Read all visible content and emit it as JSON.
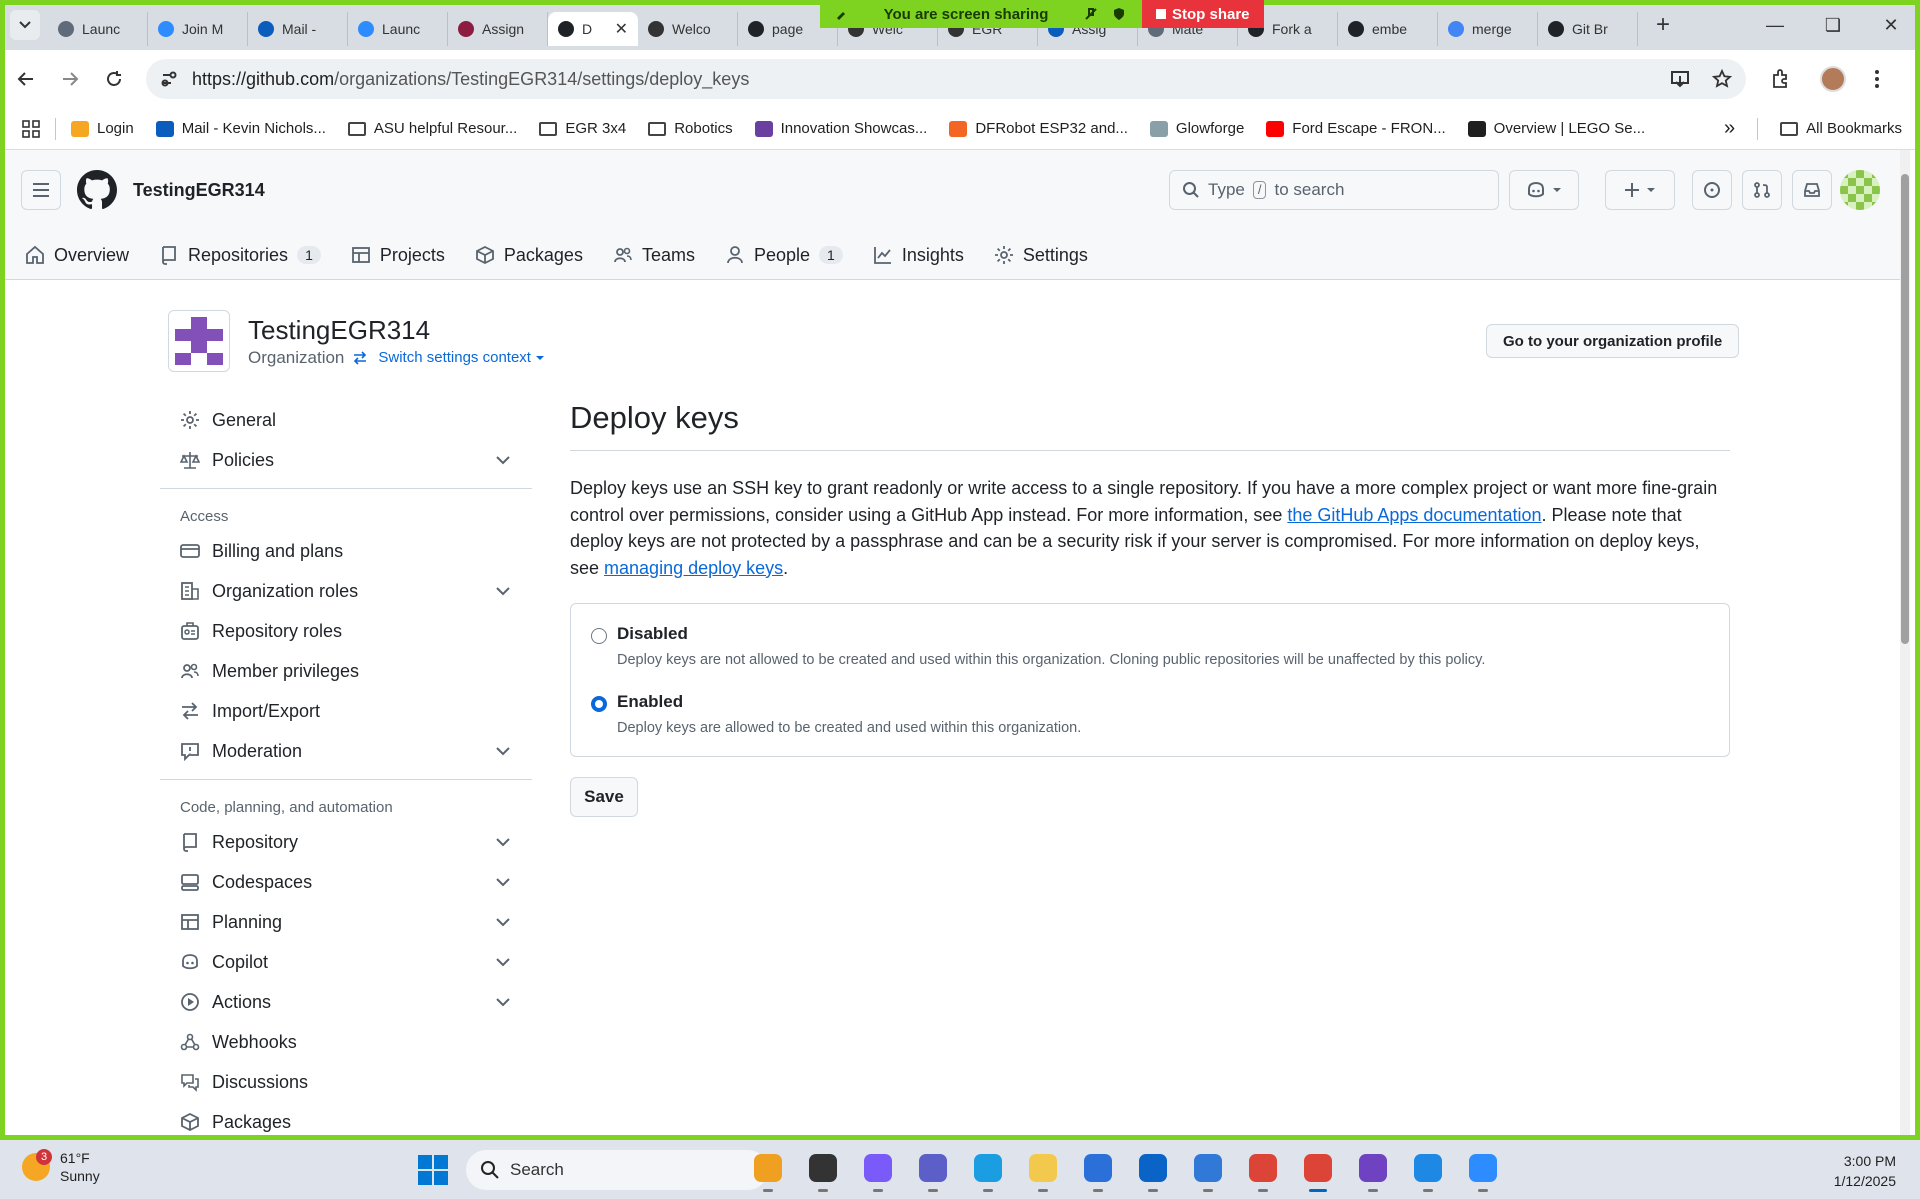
{
  "screen_share": {
    "status": "You are screen sharing",
    "stop_label": "Stop share"
  },
  "browser": {
    "tabs": [
      {
        "title": "Launc",
        "color": "#5f6b7a"
      },
      {
        "title": "Join M",
        "color": "#2d8cff"
      },
      {
        "title": "Mail -",
        "color": "#0a5cbd"
      },
      {
        "title": "Launc",
        "color": "#2d8cff"
      },
      {
        "title": "Assign",
        "color": "#8c1d40"
      },
      {
        "title": "D",
        "color": "#1f2328",
        "active": true
      },
      {
        "title": "Welco",
        "color": "#333333"
      },
      {
        "title": "page",
        "color": "#1f2328"
      },
      {
        "title": "Welc",
        "color": "#333333"
      },
      {
        "title": "EGR",
        "color": "#333333"
      },
      {
        "title": "Assig",
        "color": "#0a5cbd"
      },
      {
        "title": "Mate",
        "color": "#5f6b7a"
      },
      {
        "title": "Fork a",
        "color": "#1f2328"
      },
      {
        "title": "embe",
        "color": "#1f2328"
      },
      {
        "title": "merge",
        "color": "#4285f4"
      },
      {
        "title": "Git Br",
        "color": "#1f2328"
      }
    ],
    "url_host": "https://github.com",
    "url_path": "/organizations/TestingEGR314/settings/deploy_keys",
    "bookmarks": [
      {
        "label": "Login",
        "icon": "login-icon",
        "color": "#f5a623"
      },
      {
        "label": "Mail - Kevin Nichols...",
        "icon": "mail-icon",
        "color": "#0a5cbd"
      },
      {
        "label": "ASU helpful Resour...",
        "icon": "folder-icon"
      },
      {
        "label": "EGR 3x4",
        "icon": "folder-icon"
      },
      {
        "label": "Robotics",
        "icon": "folder-icon"
      },
      {
        "label": "Innovation Showcas...",
        "icon": "showcase-icon",
        "color": "#6b3fa0"
      },
      {
        "label": "DFRobot ESP32 and...",
        "icon": "dfrobot-icon",
        "color": "#f26522"
      },
      {
        "label": "Glowforge",
        "icon": "glowforge-icon",
        "color": "#8aa0a8"
      },
      {
        "label": "Ford Escape - FRON...",
        "icon": "youtube-icon",
        "color": "#ff0000"
      },
      {
        "label": "Overview | LEGO Se...",
        "icon": "lego-icon",
        "color": "#1f1f1f"
      }
    ],
    "all_bookmarks": "All Bookmarks"
  },
  "github": {
    "org_name": "TestingEGR314",
    "search_prefix": "Type",
    "search_key": "/",
    "search_suffix": "to search",
    "nav": [
      {
        "label": "Overview",
        "icon": "home-icon"
      },
      {
        "label": "Repositories",
        "icon": "repo-icon",
        "count": "1"
      },
      {
        "label": "Projects",
        "icon": "table-icon"
      },
      {
        "label": "Packages",
        "icon": "package-icon"
      },
      {
        "label": "Teams",
        "icon": "people-icon"
      },
      {
        "label": "People",
        "icon": "person-icon",
        "count": "1"
      },
      {
        "label": "Insights",
        "icon": "graph-icon"
      },
      {
        "label": "Settings",
        "icon": "gear-icon"
      }
    ]
  },
  "org_header": {
    "name": "TestingEGR314",
    "type": "Organization",
    "switch_label": "Switch settings context",
    "profile_button": "Go to your organization profile"
  },
  "sidebar": {
    "top": [
      {
        "label": "General",
        "icon": "gear-icon"
      },
      {
        "label": "Policies",
        "icon": "law-icon",
        "expandable": true
      }
    ],
    "access_heading": "Access",
    "access": [
      {
        "label": "Billing and plans",
        "icon": "credit-card-icon"
      },
      {
        "label": "Organization roles",
        "icon": "org-icon",
        "expandable": true
      },
      {
        "label": "Repository roles",
        "icon": "id-badge-icon"
      },
      {
        "label": "Member privileges",
        "icon": "people-icon"
      },
      {
        "label": "Import/Export",
        "icon": "arrow-switch-icon"
      },
      {
        "label": "Moderation",
        "icon": "report-icon",
        "expandable": true
      }
    ],
    "code_heading": "Code, planning, and automation",
    "code": [
      {
        "label": "Repository",
        "icon": "repo-icon",
        "expandable": true
      },
      {
        "label": "Codespaces",
        "icon": "codespaces-icon",
        "expandable": true
      },
      {
        "label": "Planning",
        "icon": "table-icon",
        "expandable": true
      },
      {
        "label": "Copilot",
        "icon": "copilot-icon",
        "expandable": true
      },
      {
        "label": "Actions",
        "icon": "play-icon",
        "expandable": true
      },
      {
        "label": "Webhooks",
        "icon": "webhook-icon"
      },
      {
        "label": "Discussions",
        "icon": "comment-discussion-icon"
      },
      {
        "label": "Packages",
        "icon": "package-icon"
      }
    ]
  },
  "main": {
    "title": "Deploy keys",
    "desc_1": "Deploy keys use an SSH key to grant readonly or write access to a single repository. If you have a more complex project or want more fine-grain control over permissions, consider using a GitHub App instead. For more information, see ",
    "desc_link_1": "the GitHub Apps documentation",
    "desc_2": ". Please note that deploy keys are not protected by a passphrase and can be a security risk if your server is compromised. For more information on deploy keys, see ",
    "desc_link_2": "managing deploy keys",
    "desc_3": ".",
    "options": [
      {
        "label": "Disabled",
        "hint": "Deploy keys are not allowed to be created and used within this organization. Cloning public repositories will be unaffected by this policy.",
        "checked": false
      },
      {
        "label": "Enabled",
        "hint": "Deploy keys are allowed to be created and used within this organization.",
        "checked": true
      }
    ],
    "save_label": "Save"
  },
  "taskbar": {
    "weather_badge": "3",
    "temperature": "61°F",
    "condition": "Sunny",
    "search_label": "Search",
    "time": "3:00 PM",
    "date": "1/12/2025",
    "apps": [
      {
        "name": "widgets-app-icon",
        "color": "#f0a020"
      },
      {
        "name": "file-viewer-icon",
        "color": "#333333"
      },
      {
        "name": "copilot-app-icon",
        "color": "#7a5af8"
      },
      {
        "name": "teams-icon",
        "color": "#5b5fc7"
      },
      {
        "name": "edge-icon",
        "color": "#1b9de2"
      },
      {
        "name": "file-explorer-icon",
        "color": "#f2c94c"
      },
      {
        "name": "store-icon",
        "color": "#2b70d8"
      },
      {
        "name": "outlook-icon",
        "color": "#0a64c8"
      },
      {
        "name": "calculator-app-icon",
        "color": "#3079d6"
      },
      {
        "name": "chrome-icon",
        "color": "#db4437"
      },
      {
        "name": "chrome-profile-icon",
        "color": "#db4437",
        "active": true
      },
      {
        "name": "github-desktop-icon",
        "color": "#6f42c1"
      },
      {
        "name": "vscode-icon",
        "color": "#1e88e5"
      },
      {
        "name": "zoom-icon",
        "color": "#2d8cff"
      }
    ]
  }
}
